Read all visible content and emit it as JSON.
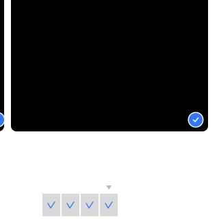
{
  "viewer": {
    "selection_color": "#3478f6",
    "previous_photo": {
      "selected": true,
      "check_icon": "checkmark-circle-icon"
    },
    "current_photo": {
      "selected": true,
      "check_icon": "checkmark-circle-icon"
    }
  },
  "thumbnail_strip": {
    "position_indicator_icon": "triangle-down-icon",
    "thumbnails": [
      {
        "selected": true,
        "icon": "checkmark-icon"
      },
      {
        "selected": true,
        "icon": "checkmark-icon"
      },
      {
        "selected": true,
        "icon": "checkmark-icon"
      },
      {
        "selected": true,
        "icon": "checkmark-icon"
      }
    ]
  }
}
